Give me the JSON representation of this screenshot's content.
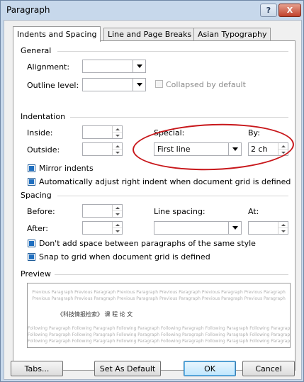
{
  "window": {
    "title": "Paragraph",
    "help_label": "?",
    "close_label": "X"
  },
  "tabs": [
    {
      "label": "Indents and Spacing",
      "active": true
    },
    {
      "label": "Line and Page Breaks",
      "active": false
    },
    {
      "label": "Asian Typography",
      "active": false
    }
  ],
  "general": {
    "section_label": "General",
    "alignment_label": "Alignment:",
    "alignment_value": "",
    "outline_label": "Outline level:",
    "outline_value": "",
    "collapsed_label": "Collapsed by default",
    "collapsed_checked": false
  },
  "indentation": {
    "section_label": "Indentation",
    "inside_label": "Inside:",
    "inside_value": "",
    "outside_label": "Outside:",
    "outside_value": "",
    "special_label": "Special:",
    "special_value": "First line",
    "by_label": "By:",
    "by_value": "2 ch",
    "mirror_label": "Mirror indents",
    "mirror_checked": true,
    "auto_adjust_label": "Automatically adjust right indent when document grid is defined",
    "auto_adjust_checked": true
  },
  "spacing": {
    "section_label": "Spacing",
    "before_label": "Before:",
    "before_value": "",
    "after_label": "After:",
    "after_value": "",
    "line_spacing_label": "Line spacing:",
    "line_spacing_value": "",
    "at_label": "At:",
    "at_value": "",
    "dont_add_label": "Don't add space between paragraphs of the same style",
    "dont_add_checked": true,
    "snap_label": "Snap to grid when document grid is defined",
    "snap_checked": true
  },
  "preview": {
    "section_label": "Preview",
    "previous_line": "Previous Paragraph Previous Paragraph Previous Paragraph Previous Paragraph Previous Paragraph Previous Paragraph",
    "sample_text": "《科技情报检索》 课 程 论 文",
    "following_line": "Following Paragraph Following Paragraph Following Paragraph Following Paragraph Following Paragraph Following Paragraph"
  },
  "buttons": {
    "tabs": "Tabs...",
    "set_default": "Set As Default",
    "ok": "OK",
    "cancel": "Cancel"
  },
  "colors": {
    "annotation_oval": "#c8171b",
    "checkbox_fill": "#1f6fc0",
    "frame": "#c7d8eb"
  }
}
